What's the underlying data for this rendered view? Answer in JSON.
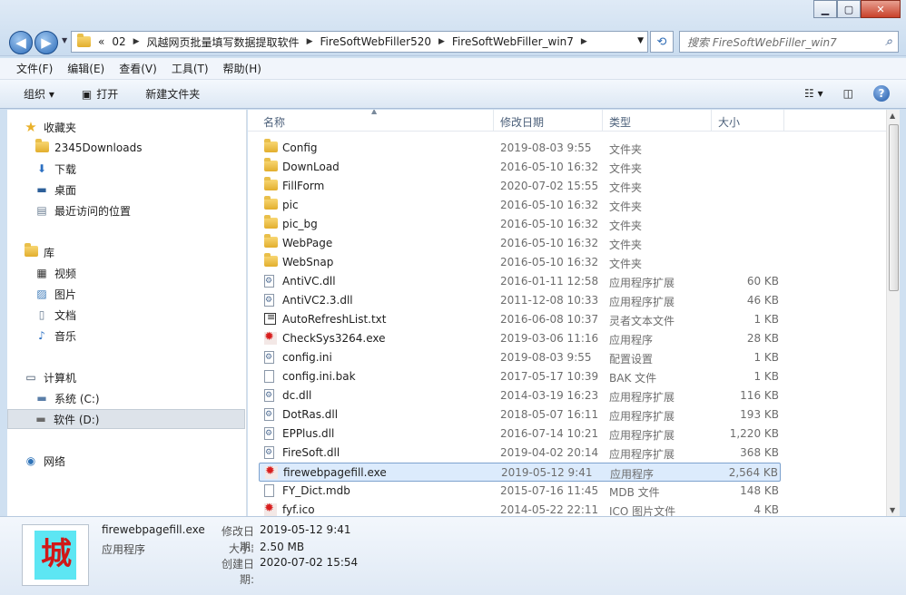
{
  "window": {
    "minimize": "▁",
    "maximize": "▢",
    "close": "✕"
  },
  "nav": {
    "back": "◀",
    "forward": "▶",
    "dropdown": "▼"
  },
  "address": {
    "overflow": "«",
    "crumbs": [
      "02",
      "风越网页批量填写数据提取软件",
      "FireSoftWebFiller520",
      "FireSoftWebFiller_win7"
    ],
    "sep": "▶"
  },
  "search": {
    "placeholder": "搜索 FireSoftWebFiller_win7"
  },
  "menu": [
    "文件(F)",
    "编辑(E)",
    "查看(V)",
    "工具(T)",
    "帮助(H)"
  ],
  "toolbar": {
    "organize": "组织 ▾",
    "open": "打开",
    "new_folder": "新建文件夹"
  },
  "sidebar": {
    "favorites": "收藏夹",
    "downloads_2345": "2345Downloads",
    "downloads": "下载",
    "desktop": "桌面",
    "recent": "最近访问的位置",
    "libraries": "库",
    "videos": "视频",
    "pictures": "图片",
    "documents": "文档",
    "music": "音乐",
    "computer": "计算机",
    "drive_c": "系统 (C:)",
    "drive_d": "软件 (D:)",
    "network": "网络"
  },
  "columns": {
    "name": "名称",
    "date": "修改日期",
    "type": "类型",
    "size": "大小"
  },
  "files": [
    {
      "name": "Config",
      "date": "2019-08-03 9:55",
      "type": "文件夹",
      "size": "",
      "icon": "folder"
    },
    {
      "name": "DownLoad",
      "date": "2016-05-10 16:32",
      "type": "文件夹",
      "size": "",
      "icon": "folder"
    },
    {
      "name": "FillForm",
      "date": "2020-07-02 15:55",
      "type": "文件夹",
      "size": "",
      "icon": "folder"
    },
    {
      "name": "pic",
      "date": "2016-05-10 16:32",
      "type": "文件夹",
      "size": "",
      "icon": "folder"
    },
    {
      "name": "pic_bg",
      "date": "2016-05-10 16:32",
      "type": "文件夹",
      "size": "",
      "icon": "folder"
    },
    {
      "name": "WebPage",
      "date": "2016-05-10 16:32",
      "type": "文件夹",
      "size": "",
      "icon": "folder"
    },
    {
      "name": "WebSnap",
      "date": "2016-05-10 16:32",
      "type": "文件夹",
      "size": "",
      "icon": "folder"
    },
    {
      "name": "AntiVC.dll",
      "date": "2016-01-11 12:58",
      "type": "应用程序扩展",
      "size": "60 KB",
      "icon": "dll"
    },
    {
      "name": "AntiVC2.3.dll",
      "date": "2011-12-08 10:33",
      "type": "应用程序扩展",
      "size": "46 KB",
      "icon": "dll"
    },
    {
      "name": "AutoRefreshList.txt",
      "date": "2016-06-08 10:37",
      "type": "灵者文本文件",
      "size": "1 KB",
      "icon": "txt"
    },
    {
      "name": "CheckSys3264.exe",
      "date": "2019-03-06 11:16",
      "type": "应用程序",
      "size": "28 KB",
      "icon": "exe"
    },
    {
      "name": "config.ini",
      "date": "2019-08-03 9:55",
      "type": "配置设置",
      "size": "1 KB",
      "icon": "ini"
    },
    {
      "name": "config.ini.bak",
      "date": "2017-05-17 10:39",
      "type": "BAK 文件",
      "size": "1 KB",
      "icon": "doc"
    },
    {
      "name": "dc.dll",
      "date": "2014-03-19 16:23",
      "type": "应用程序扩展",
      "size": "116 KB",
      "icon": "dll"
    },
    {
      "name": "DotRas.dll",
      "date": "2018-05-07 16:11",
      "type": "应用程序扩展",
      "size": "193 KB",
      "icon": "dll"
    },
    {
      "name": "EPPlus.dll",
      "date": "2016-07-14 10:21",
      "type": "应用程序扩展",
      "size": "1,220 KB",
      "icon": "dll"
    },
    {
      "name": "FireSoft.dll",
      "date": "2019-04-02 20:14",
      "type": "应用程序扩展",
      "size": "368 KB",
      "icon": "dll"
    },
    {
      "name": "firewebpagefill.exe",
      "date": "2019-05-12 9:41",
      "type": "应用程序",
      "size": "2,564 KB",
      "icon": "exe",
      "selected": true
    },
    {
      "name": "FY_Dict.mdb",
      "date": "2015-07-16 11:45",
      "type": "MDB 文件",
      "size": "148 KB",
      "icon": "doc"
    },
    {
      "name": "fyf.ico",
      "date": "2014-05-22 22:11",
      "type": "ICO 图片文件",
      "size": "4 KB",
      "icon": "exe"
    }
  ],
  "details": {
    "name": "firewebpagefill.exe",
    "type": "应用程序",
    "modified_label": "修改日期:",
    "modified": "2019-05-12 9:41",
    "size_label": "大小:",
    "size": "2.50 MB",
    "created_label": "创建日期:",
    "created": "2020-07-02 15:54",
    "logo_text": "城"
  },
  "scroll": {
    "up": "▲",
    "down": "▼"
  }
}
